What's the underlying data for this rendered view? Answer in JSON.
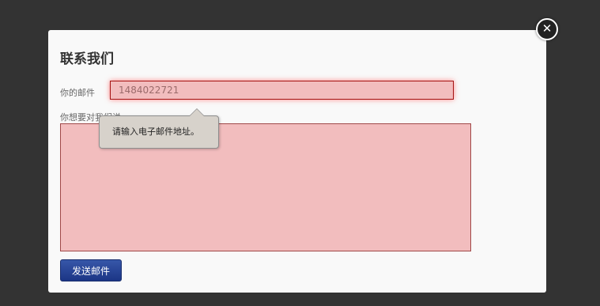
{
  "modal": {
    "title": "联系我们",
    "email_label": "你的邮件",
    "email_value": "1484022721",
    "message_label": "你想要对我们说",
    "message_value": "",
    "validation_tooltip": "请输入电子邮件地址。",
    "send_button_label": "发送邮件",
    "close_icon": "close-icon"
  },
  "colors": {
    "overlay": "#333333",
    "modal_background": "#f9f9f9",
    "invalid_field": "#f2bdbe",
    "send_button": "#1b3585"
  }
}
